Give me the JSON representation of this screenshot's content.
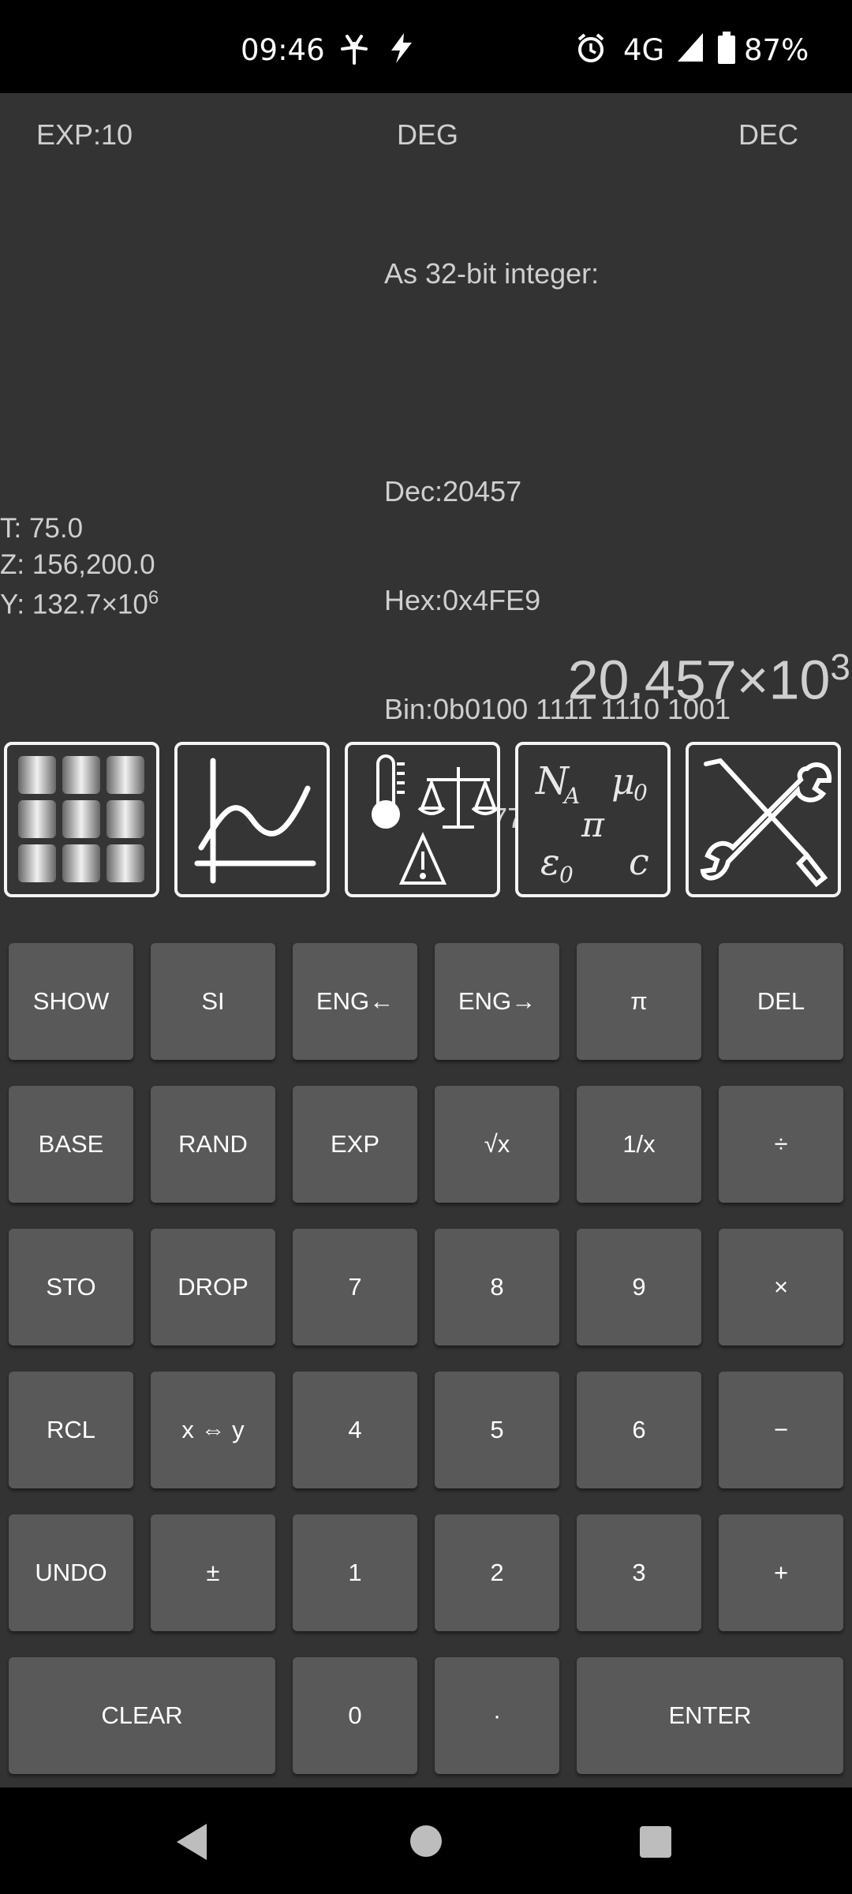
{
  "status_bar": {
    "time": "09:46",
    "network": "4G",
    "battery": "87%",
    "icons": [
      "pinwheel-icon",
      "bolt-icon",
      "alarm-icon",
      "signal-icon",
      "battery-icon"
    ]
  },
  "display": {
    "mode_exp": "EXP:10",
    "mode_angle": "DEG",
    "mode_base": "DEC",
    "info_header": "As 32-bit integer:",
    "info_dec": "Dec:20457",
    "info_hex": "Hex:0x4FE9",
    "info_bin": "Bin:0b0100 1111 1110 1001",
    "info_oct": "Oct:0o4 7751",
    "stack_t": "T: 75.0",
    "stack_z": "Z: 156,200.0",
    "stack_y_base": "Y: 132.7×10",
    "stack_y_exp": "6",
    "x_base": "20.457×10",
    "x_exp": "3"
  },
  "menu_icons": [
    "matrix-menu-icon",
    "graph-menu-icon",
    "units-menu-icon",
    "constants-menu-icon",
    "settings-tools-icon"
  ],
  "constants_icon_text": {
    "na": "N",
    "na_sub": "A",
    "mu": "μ",
    "mu_sub": "0",
    "pi": "π",
    "eps": "ε",
    "eps_sub": "0",
    "c": "c"
  },
  "keys": {
    "show": "SHOW",
    "si": "SI",
    "eng_left": "ENG←",
    "eng_right": "ENG→",
    "pi": "π",
    "del": "DEL",
    "base": "BASE",
    "rand": "RAND",
    "exp": "EXP",
    "sqrt": "√x",
    "inv": "1/x",
    "div": "÷",
    "sto": "STO",
    "drop": "DROP",
    "k7": "7",
    "k8": "8",
    "k9": "9",
    "mul": "×",
    "rcl": "RCL",
    "swap": "x ⇔ y",
    "k4": "4",
    "k5": "5",
    "k6": "6",
    "sub": "−",
    "undo": "UNDO",
    "neg": "±",
    "k1": "1",
    "k2": "2",
    "k3": "3",
    "add": "+",
    "clear": "CLEAR",
    "k0": "0",
    "dot": "·",
    "enter": "ENTER"
  },
  "nav_icons": [
    "back-icon",
    "home-icon",
    "recents-icon"
  ]
}
